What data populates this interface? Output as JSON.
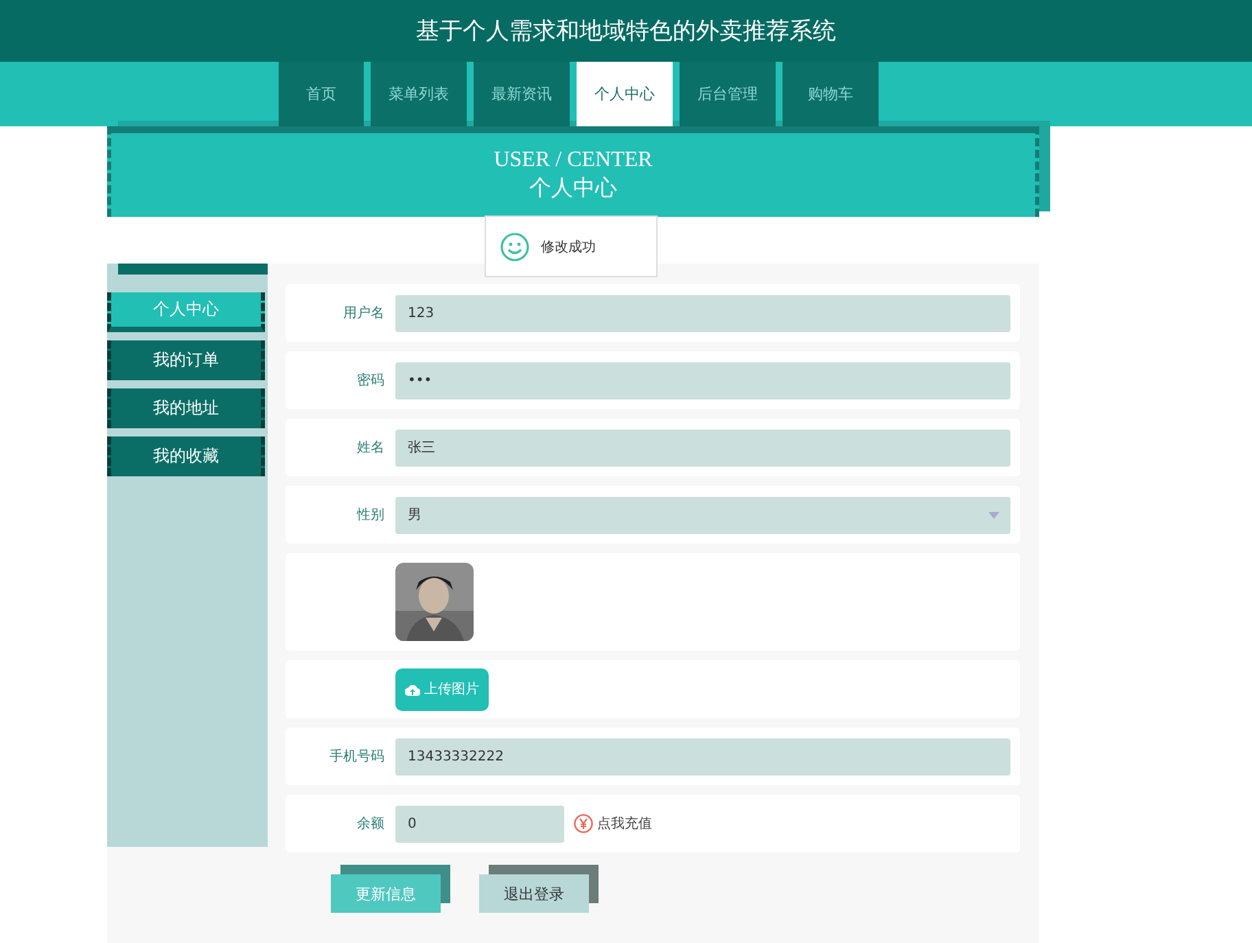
{
  "header": {
    "title": "基于个人需求和地域特色的外卖推荐系统"
  },
  "nav": [
    {
      "label": "首页",
      "selected": false
    },
    {
      "label": "菜单列表",
      "selected": false
    },
    {
      "label": "最新资讯",
      "selected": false
    },
    {
      "label": "个人中心",
      "selected": true
    },
    {
      "label": "后台管理",
      "selected": false
    },
    {
      "label": "购物车",
      "selected": false
    }
  ],
  "banner": {
    "title_en": "USER / CENTER",
    "title_zh": "个人中心"
  },
  "toast": {
    "message": "修改成功"
  },
  "sidebar": {
    "items": [
      {
        "label": "个人中心",
        "selected": true
      },
      {
        "label": "我的订单",
        "selected": false
      },
      {
        "label": "我的地址",
        "selected": false
      },
      {
        "label": "我的收藏",
        "selected": false
      }
    ]
  },
  "form": {
    "fields": [
      {
        "kind": "text",
        "label": "用户名",
        "value": "123"
      },
      {
        "kind": "text",
        "label": "密码",
        "value": "•••"
      },
      {
        "kind": "text",
        "label": "姓名",
        "value": "张三"
      },
      {
        "kind": "select",
        "label": "性别",
        "value": "男"
      },
      {
        "kind": "avatar"
      },
      {
        "kind": "upload",
        "button": "上传图片"
      },
      {
        "kind": "text",
        "label": "手机号码",
        "value": "13433332222"
      },
      {
        "kind": "balance",
        "label": "余额",
        "value": "0",
        "link": "点我充值"
      }
    ]
  },
  "buttons": [
    {
      "kind": "primary",
      "label": "更新信息"
    },
    {
      "kind": "secondary",
      "label": "退出登录"
    }
  ]
}
